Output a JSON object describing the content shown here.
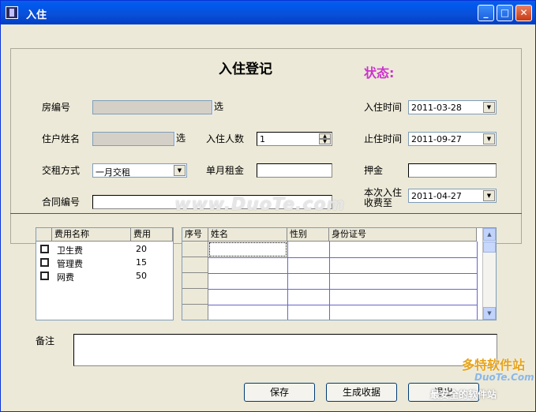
{
  "window": {
    "title": "入住"
  },
  "form": {
    "heading": "入住登记",
    "status_label": "状态:",
    "room_no_label": "房编号",
    "resident_name_label": "住户姓名",
    "rent_mode_label": "交租方式",
    "contract_no_label": "合同编号",
    "pick_label": "选",
    "occupants_label": "入住人数",
    "occupants_value": "1",
    "monthly_rent_label": "单月租金",
    "checkin_time_label": "入住时间",
    "checkin_time_value": "2011-03-28",
    "checkout_time_label": "止住时间",
    "checkout_time_value": "2011-09-27",
    "deposit_label": "押金",
    "paid_until_label_line1": "本次入住",
    "paid_until_label_line2": "收费至",
    "paid_until_value": "2011-04-27",
    "rent_mode_value": "一月交租"
  },
  "fees": {
    "headers": [
      "费用名称",
      "费用"
    ],
    "rows": [
      {
        "name": "卫生费",
        "amount": "20"
      },
      {
        "name": "管理费",
        "amount": "15"
      },
      {
        "name": "网费",
        "amount": "50"
      }
    ]
  },
  "occupants": {
    "headers": [
      "序号",
      "姓名",
      "性别",
      "身份证号"
    ]
  },
  "remarks_label": "备注",
  "buttons": {
    "save": "保存",
    "receipt": "生成收据",
    "exit": "退出"
  },
  "watermark": {
    "center": "www.DuoTe.com",
    "logo_cn": "多特软件站",
    "logo_dt": "DuoTe.Com",
    "logo_tag": "最安全的软件站"
  }
}
